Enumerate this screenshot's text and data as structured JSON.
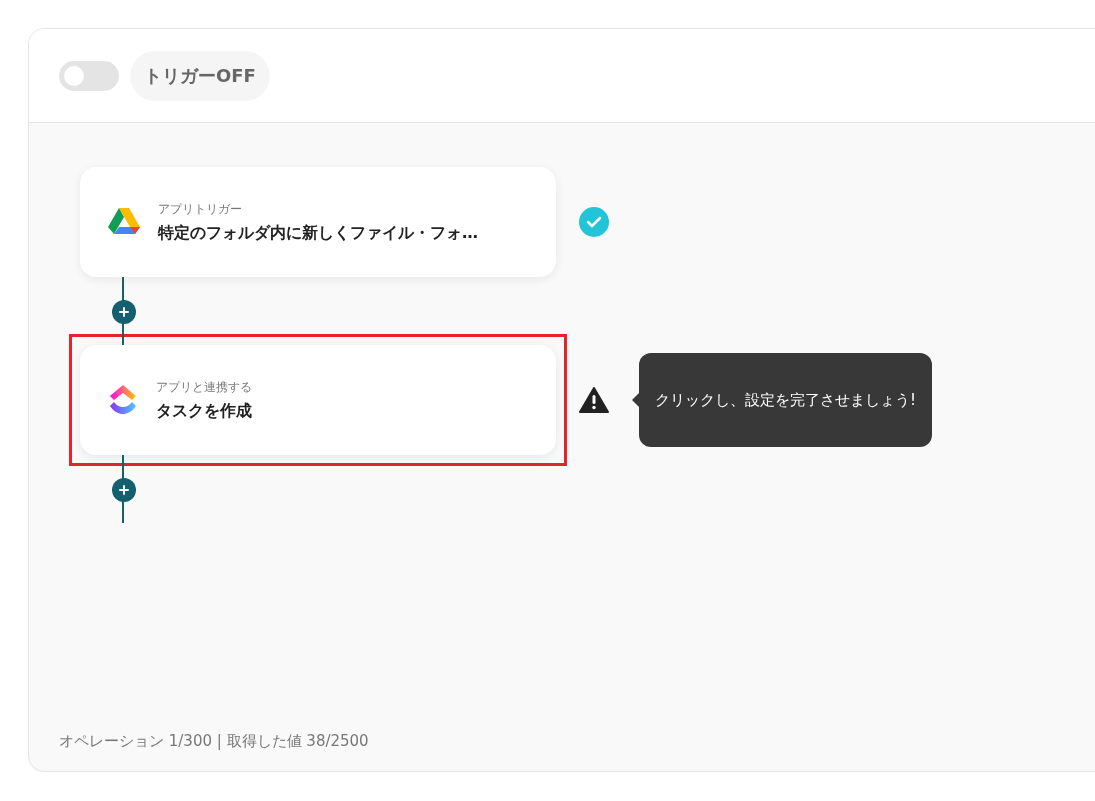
{
  "trigger_toggle": {
    "on": false,
    "label": "トリガーOFF"
  },
  "steps": [
    {
      "kind": "drive",
      "label": "アプリトリガー",
      "title": "特定のフォルダ内に新しくファイル・フォ…",
      "complete": true,
      "highlighted": false
    },
    {
      "kind": "clickup",
      "label": "アプリと連携する",
      "title": "タスクを作成",
      "complete": false,
      "highlighted": true,
      "tooltip": "クリックし、設定を完了させましょう!"
    }
  ],
  "footer": "オペレーション 1/300 | 取得した値 38/2500"
}
